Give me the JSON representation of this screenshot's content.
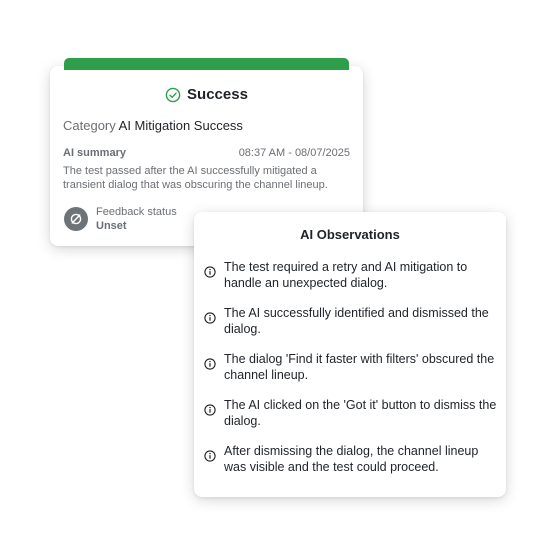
{
  "success_card": {
    "title": "Success",
    "category_label": "Category",
    "category_value": "AI Mitigation Success",
    "summary_label": "AI summary",
    "summary_time": "08:37 AM - 08/07/2025",
    "summary_text": "The test passed after the AI successfully mitigated a transient dialog that was obscuring the channel lineup.",
    "feedback_label": "Feedback status",
    "feedback_value": "Unset",
    "colors": {
      "accent": "#2e9e4a",
      "icon_gray": "#6e7378"
    },
    "icons": {
      "title": "check-circle-icon",
      "feedback": "unset-circle-icon"
    }
  },
  "observations_card": {
    "title": "AI Observations",
    "items": [
      "The test required a retry and AI mitigation to handle an unexpected dialog.",
      "The AI successfully identified and dismissed the dialog.",
      "The dialog 'Find it faster with filters' obscured the channel lineup.",
      "The AI clicked on the 'Got it' button to dismiss the dialog.",
      "After dismissing the dialog, the channel lineup was visible and the test could proceed."
    ],
    "icon": "info-icon"
  }
}
